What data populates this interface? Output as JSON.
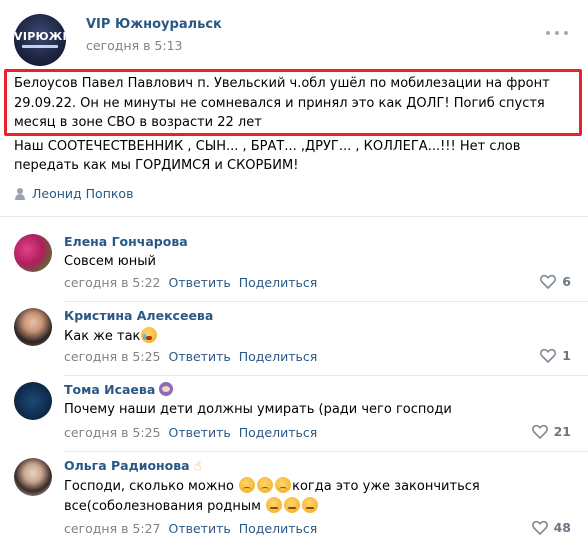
{
  "post": {
    "group_name": "VIP Южноуральск",
    "group_logo_text": "VIPЮЖК",
    "time": "сегодня в 5:13",
    "highlight_text": "Белоусов Павел Павлович п. Увельский ч.обл ушёл по мобилезации на фронт 29.09.22. Он не минуты не сомневался и принял это как ДОЛГ! Погиб спустя месяц в зоне СВО в возрасти 22 лет",
    "text_rest": "Наш СООТЕЧЕСТВЕННИК , СЫН... , БРАТ... ,ДРУГ... , КОЛЛЕГА...!!! Нет слов передать как мы ГОРДИМСЯ и СКОРБИМ!",
    "author": "Леонид Попков",
    "highlight_color": "#e8222b",
    "link_color": "#2a5885"
  },
  "actions": {
    "reply": "Ответить",
    "share": "Поделиться"
  },
  "comments": [
    {
      "name": "Елена Гончарова",
      "text": "Совсем юный",
      "time": "сегодня в 5:22",
      "likes": "6"
    },
    {
      "name": "Кристина Алексеева",
      "text": "Как же так",
      "time": "сегодня в 5:25",
      "likes": "1"
    },
    {
      "name": "Тома Исаева",
      "text": "Почему наши дети должны умирать (ради чего господи",
      "time": "сегодня в 5:25",
      "likes": "21"
    },
    {
      "name": "Ольга Радионова",
      "text_part1": "Господи, сколько можно",
      "text_part2": "когда это уже закончиться",
      "text_part3": "все(соболезнования родным",
      "time": "сегодня в 5:27",
      "likes": "48"
    }
  ]
}
